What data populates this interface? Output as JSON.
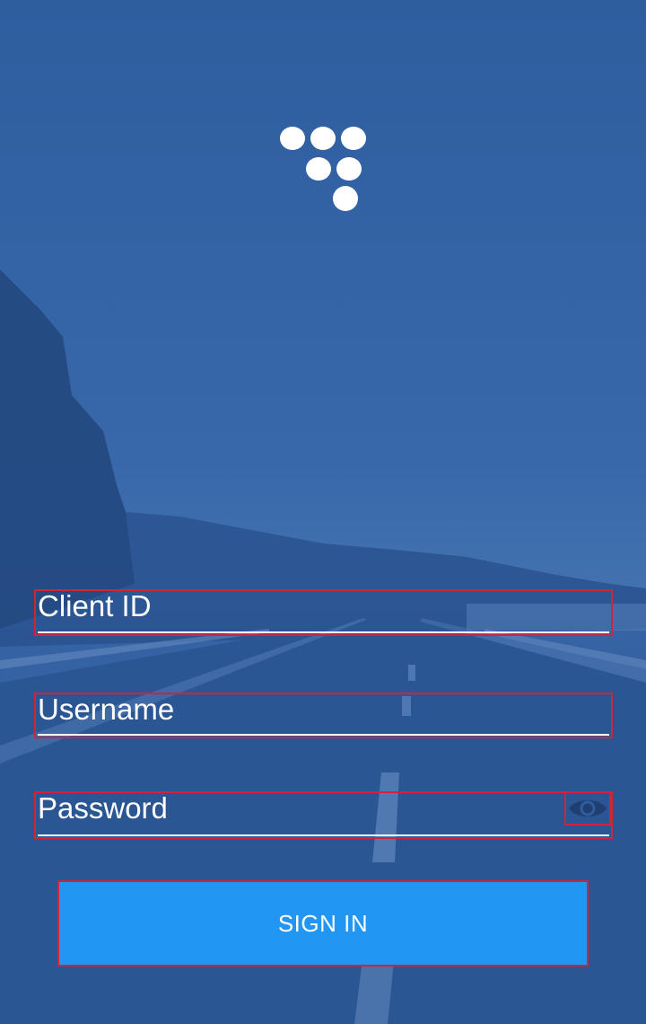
{
  "app": {
    "logo_icon": "dots-cluster-logo-icon"
  },
  "form": {
    "client_id": {
      "label": "Client ID",
      "value": ""
    },
    "username": {
      "label": "Username",
      "value": ""
    },
    "password": {
      "label": "Password",
      "value": "",
      "toggle_icon": "eye-icon"
    }
  },
  "actions": {
    "sign_in_label": "SIGN IN"
  },
  "colors": {
    "background_tint": "#2f5d9e",
    "button": "#2196f3",
    "text": "#ffffff",
    "eye_icon": "#1f3f70"
  }
}
